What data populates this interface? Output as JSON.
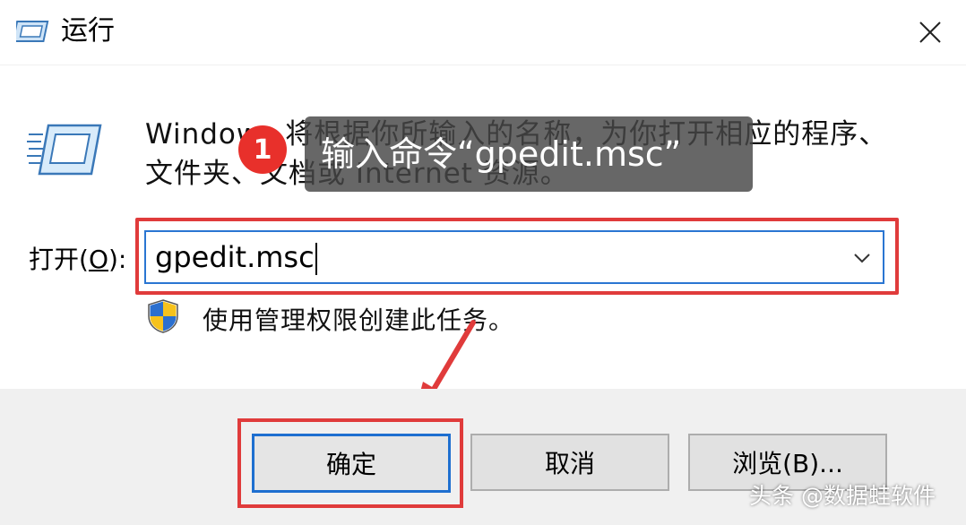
{
  "window": {
    "title": "运行",
    "close_symbol": "✕",
    "icons": {
      "app": "run-icon",
      "close": "close-icon"
    }
  },
  "description": "Windows 将根据你所输入的名称，为你打开相应的程序、文件夹、文档或 Internet 资源。",
  "annotation": {
    "step_number": "1",
    "tooltip": "输入命令“gpedit.msc”",
    "highlight_color": "#e03b3b",
    "badge_color": "#e8302b"
  },
  "open_field": {
    "label_prefix": "打开(",
    "label_accel": "O",
    "label_suffix": "):",
    "value": "gpedit.msc",
    "focus_color": "#2a76d2"
  },
  "admin_note": {
    "text": "使用管理权限创建此任务。",
    "icon": "uac-shield-icon"
  },
  "buttons": {
    "ok": "确定",
    "cancel": "取消",
    "browse": "浏览(B)..."
  },
  "watermark": "头条 @数据蛙软件"
}
